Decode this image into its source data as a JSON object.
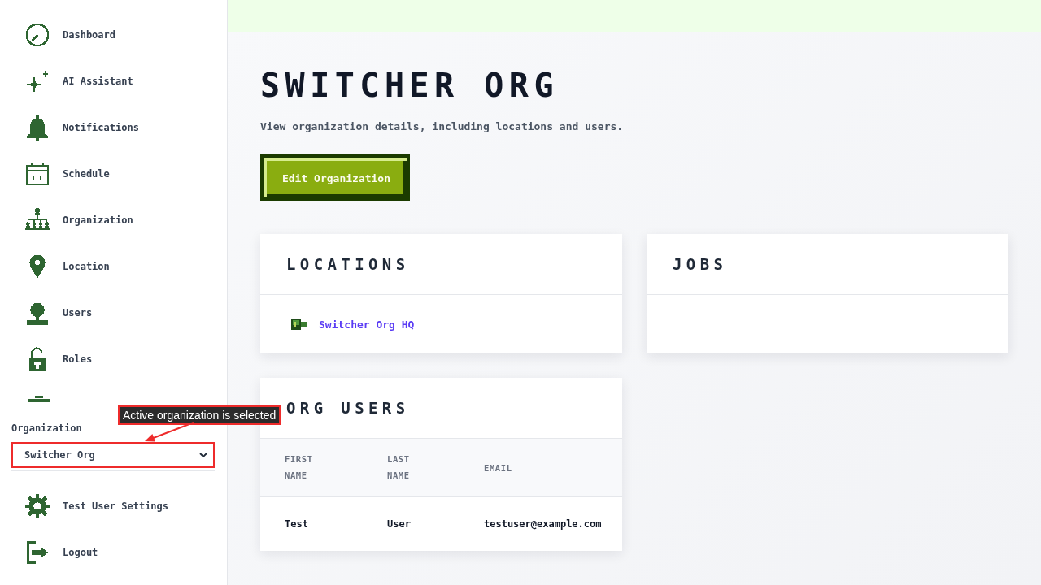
{
  "sidebar": {
    "nav_items": [
      {
        "label": "Dashboard"
      },
      {
        "label": "AI Assistant"
      },
      {
        "label": "Notifications"
      },
      {
        "label": "Schedule"
      },
      {
        "label": "Organization"
      },
      {
        "label": "Location"
      },
      {
        "label": "Users"
      },
      {
        "label": "Roles"
      }
    ],
    "org_switcher": {
      "label": "Organization",
      "value": "Switcher Org",
      "highlighted": true
    },
    "footer_items": [
      {
        "label": "Test User Settings"
      },
      {
        "label": "Logout"
      }
    ]
  },
  "page": {
    "title": "SWITCHER ORG",
    "subtitle": "View organization details, including locations and users.",
    "edit_button": "Edit Organization"
  },
  "locations_card": {
    "title": "LOCATIONS",
    "items": [
      "Switcher Org HQ"
    ]
  },
  "jobs_card": {
    "title": "JOBS"
  },
  "users_card": {
    "title": "ORG USERS",
    "columns": [
      "FIRST NAME",
      "LAST NAME",
      "EMAIL"
    ],
    "rows": [
      [
        "Test",
        "User",
        "testuser@example.com"
      ]
    ]
  },
  "annotation": {
    "text": "Active organization is selected"
  }
}
